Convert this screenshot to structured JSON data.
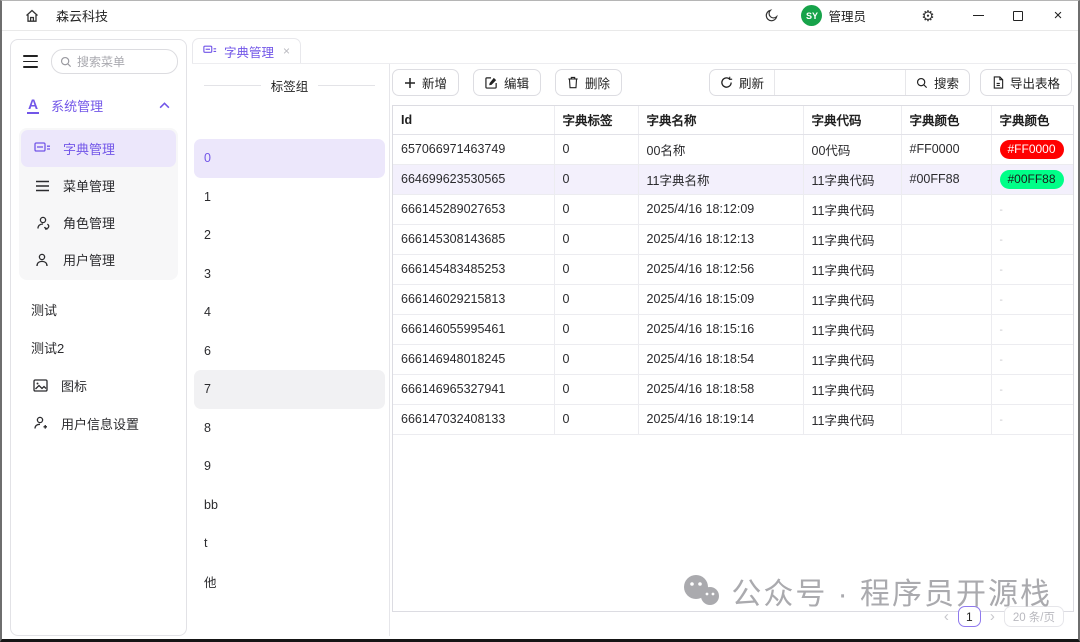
{
  "colors": {
    "accent": "#7256E8",
    "accent_light": "#ECE7FB",
    "avatar_bg": "#17A34A",
    "badge_red": "#FF0000",
    "badge_green": "#00FF88"
  },
  "titlebar": {
    "app_title": "森云科技",
    "avatar_text": "SY",
    "user_name": "管理员"
  },
  "sidebar": {
    "search_placeholder": "搜索菜单",
    "group": {
      "label": "系统管理",
      "expanded": true,
      "children": [
        {
          "key": "dict",
          "label": "字典管理",
          "icon": "dict-icon",
          "selected": true
        },
        {
          "key": "menu",
          "label": "菜单管理",
          "icon": "menu-icon",
          "selected": false
        },
        {
          "key": "role",
          "label": "角色管理",
          "icon": "role-icon",
          "selected": false
        },
        {
          "key": "user",
          "label": "用户管理",
          "icon": "user-icon",
          "selected": false
        }
      ]
    },
    "root_items": [
      {
        "key": "test",
        "label": "测试",
        "icon": null
      },
      {
        "key": "test2",
        "label": "测试2",
        "icon": null
      },
      {
        "key": "icons",
        "label": "图标",
        "icon": "image-icon"
      },
      {
        "key": "userinfo",
        "label": "用户信息设置",
        "icon": "user-plus-icon"
      }
    ]
  },
  "tabs": [
    {
      "label": "字典管理",
      "active": true
    }
  ],
  "tag_panel": {
    "title": "标签组",
    "items": [
      "0",
      "1",
      "2",
      "3",
      "4",
      "6",
      "7",
      "8",
      "9",
      "bb",
      "t",
      "他"
    ],
    "selected_index": 0,
    "hover_index": 6
  },
  "toolbar": {
    "add_label": "新增",
    "edit_label": "编辑",
    "delete_label": "删除",
    "refresh_label": "刷新",
    "search_label": "搜索",
    "export_label": "导出表格",
    "search_value": ""
  },
  "table": {
    "columns": [
      "Id",
      "字典标签",
      "字典名称",
      "字典代码",
      "字典颜色",
      "字典颜色"
    ],
    "rows": [
      {
        "id": "657066971463749",
        "label": "0",
        "name": "00名称",
        "code": "00代码",
        "color": "#FF0000",
        "badge": "#FF0000",
        "badge_bg": "#FF0000",
        "badge_fg": "#FFFFFF",
        "selected": false
      },
      {
        "id": "664699623530565",
        "label": "0",
        "name": "11字典名称",
        "code": "11字典代码",
        "color": "#00FF88",
        "badge": "#00FF88",
        "badge_bg": "#00FF88",
        "badge_fg": "#1A1A1A",
        "selected": true
      },
      {
        "id": "666145289027653",
        "label": "0",
        "name": "2025/4/16 18:12:09",
        "code": "11字典代码",
        "color": "",
        "badge": "-",
        "badge_bg": null,
        "badge_fg": null,
        "selected": false
      },
      {
        "id": "666145308143685",
        "label": "0",
        "name": "2025/4/16 18:12:13",
        "code": "11字典代码",
        "color": "",
        "badge": "-",
        "badge_bg": null,
        "badge_fg": null,
        "selected": false
      },
      {
        "id": "666145483485253",
        "label": "0",
        "name": "2025/4/16 18:12:56",
        "code": "11字典代码",
        "color": "",
        "badge": "-",
        "badge_bg": null,
        "badge_fg": null,
        "selected": false
      },
      {
        "id": "666146029215813",
        "label": "0",
        "name": "2025/4/16 18:15:09",
        "code": "11字典代码",
        "color": "",
        "badge": "-",
        "badge_bg": null,
        "badge_fg": null,
        "selected": false
      },
      {
        "id": "666146055995461",
        "label": "0",
        "name": "2025/4/16 18:15:16",
        "code": "11字典代码",
        "color": "",
        "badge": "-",
        "badge_bg": null,
        "badge_fg": null,
        "selected": false
      },
      {
        "id": "666146948018245",
        "label": "0",
        "name": "2025/4/16 18:18:54",
        "code": "11字典代码",
        "color": "",
        "badge": "-",
        "badge_bg": null,
        "badge_fg": null,
        "selected": false
      },
      {
        "id": "666146965327941",
        "label": "0",
        "name": "2025/4/16 18:18:58",
        "code": "11字典代码",
        "color": "",
        "badge": "-",
        "badge_bg": null,
        "badge_fg": null,
        "selected": false
      },
      {
        "id": "666147032408133",
        "label": "0",
        "name": "2025/4/16 18:19:14",
        "code": "11字典代码",
        "color": "",
        "badge": "-",
        "badge_bg": null,
        "badge_fg": null,
        "selected": false
      }
    ]
  },
  "pagination": {
    "current_page": "1",
    "page_size_label": "20 条/页"
  },
  "watermark": {
    "text": "公众号 · 程序员开源栈"
  }
}
